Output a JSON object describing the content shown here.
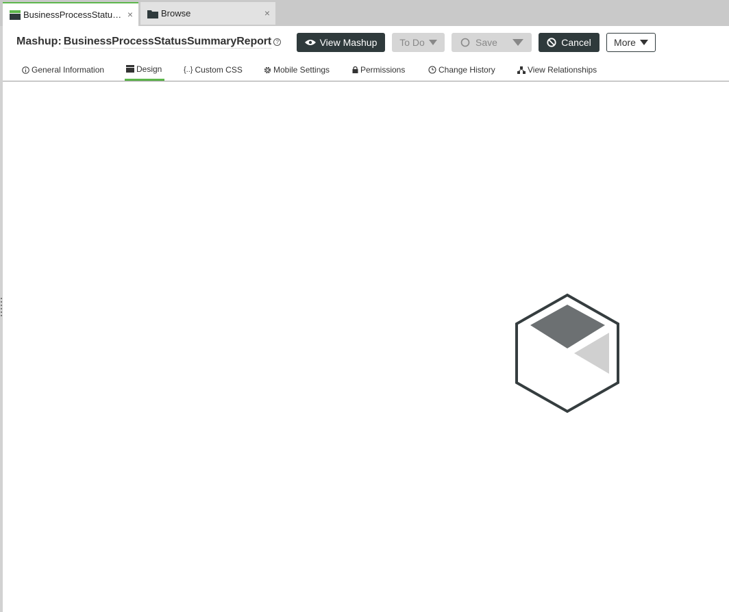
{
  "tabs": [
    {
      "label": "BusinessProcessStatusSummaryReport",
      "close": "×"
    },
    {
      "label": "Browse",
      "close": "×"
    }
  ],
  "header": {
    "label": "Mashup:",
    "name": "BusinessProcessStatusSummaryReport",
    "help": "?"
  },
  "toolbar": {
    "view_label": "View Mashup",
    "todo_label": "To Do",
    "save_label": "Save",
    "cancel_label": "Cancel",
    "more_label": "More"
  },
  "subtabs": [
    {
      "label": "General Information",
      "icon": "info-icon"
    },
    {
      "label": "Design",
      "icon": "design-icon"
    },
    {
      "label": "Custom CSS",
      "icon": "braces-icon"
    },
    {
      "label": "Mobile Settings",
      "icon": "gear-icon"
    },
    {
      "label": "Permissions",
      "icon": "lock-icon"
    },
    {
      "label": "Change History",
      "icon": "clock-icon"
    },
    {
      "label": "View Relationships",
      "icon": "relationships-icon"
    }
  ],
  "colors": {
    "accent": "#5db64b",
    "dark": "#2f3a3c",
    "disabled": "#d6d6d6"
  }
}
